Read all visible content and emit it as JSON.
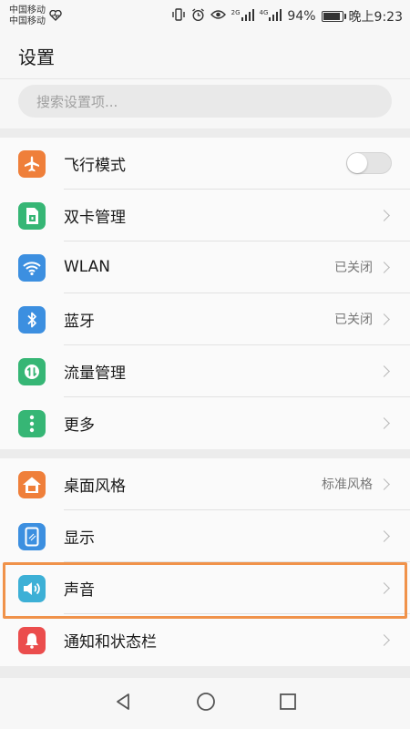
{
  "status": {
    "carrier1": "中国移动",
    "carrier2": "中国移动",
    "net1": "2G",
    "net2": "4G",
    "battery": "94%",
    "battery_level": 0.94,
    "time": "晚上9:23"
  },
  "header": {
    "title": "设置"
  },
  "search": {
    "placeholder": "搜索设置项..."
  },
  "sections": [
    {
      "items": [
        {
          "label": "飞行模式",
          "icon": "airplane-icon",
          "color": "#ef7f3a",
          "toggle": false
        },
        {
          "label": "双卡管理",
          "icon": "sim-card-icon",
          "color": "#36b675"
        },
        {
          "label": "WLAN",
          "icon": "wifi-icon",
          "color": "#3c8fe0",
          "value": "已关闭"
        },
        {
          "label": "蓝牙",
          "icon": "bluetooth-icon",
          "color": "#3c8fe0",
          "value": "已关闭"
        },
        {
          "label": "流量管理",
          "icon": "data-usage-icon",
          "color": "#36b675"
        },
        {
          "label": "更多",
          "icon": "more-icon",
          "color": "#36b675"
        }
      ]
    },
    {
      "items": [
        {
          "label": "桌面风格",
          "icon": "home-icon",
          "color": "#ef7f3a",
          "value": "标准风格"
        },
        {
          "label": "显示",
          "icon": "display-icon",
          "color": "#3c8fe0"
        },
        {
          "label": "声音",
          "icon": "speaker-icon",
          "color": "#3db0d6"
        },
        {
          "label": "通知和状态栏",
          "icon": "bell-icon",
          "color": "#eb4d4d"
        }
      ]
    }
  ]
}
